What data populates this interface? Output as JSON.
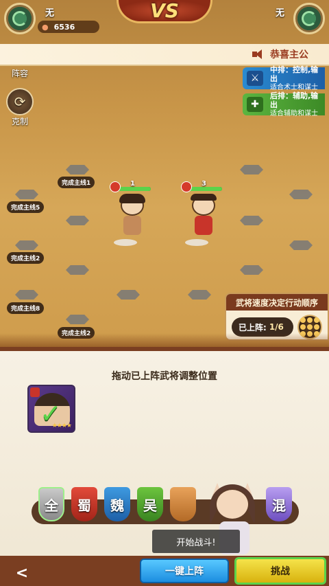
{
  "header": {
    "left_player": "无",
    "right_player": "无",
    "vs": "VS",
    "power": "6536"
  },
  "notice": "恭喜主公",
  "side": {
    "lineup": "阵容",
    "counter": "克制"
  },
  "row_tags": {
    "middle": {
      "title": "中排：控制,输出",
      "desc": "适合术士和谋士"
    },
    "back": {
      "title": "后排：辅助,输出",
      "desc": "适合辅助和谋士"
    }
  },
  "quests": [
    "完成主线1",
    "完成主线5",
    "完成主线2",
    "完成主线8",
    "完成主线2"
  ],
  "heroes": [
    {
      "level": "1"
    },
    {
      "level": "3"
    }
  ],
  "speed_panel": {
    "title": "武将速度决定行动顺序",
    "deployed_label": "已上阵:",
    "deployed_count": "1/6"
  },
  "panel": {
    "title": "拖动已上阵武将调整位置"
  },
  "factions": [
    "全",
    "蜀",
    "魏",
    "吴",
    "混"
  ],
  "tip": "开始战斗!",
  "buttons": {
    "back": "<",
    "auto_deploy": "一键上阵",
    "challenge": "挑战"
  },
  "colors": {
    "faction_all": "#9a9a9a",
    "faction_shu": "#c8342a",
    "faction_wei": "#2d7fc4",
    "faction_wu": "#4ea82c",
    "faction_mixed": "#8f6fd0"
  }
}
